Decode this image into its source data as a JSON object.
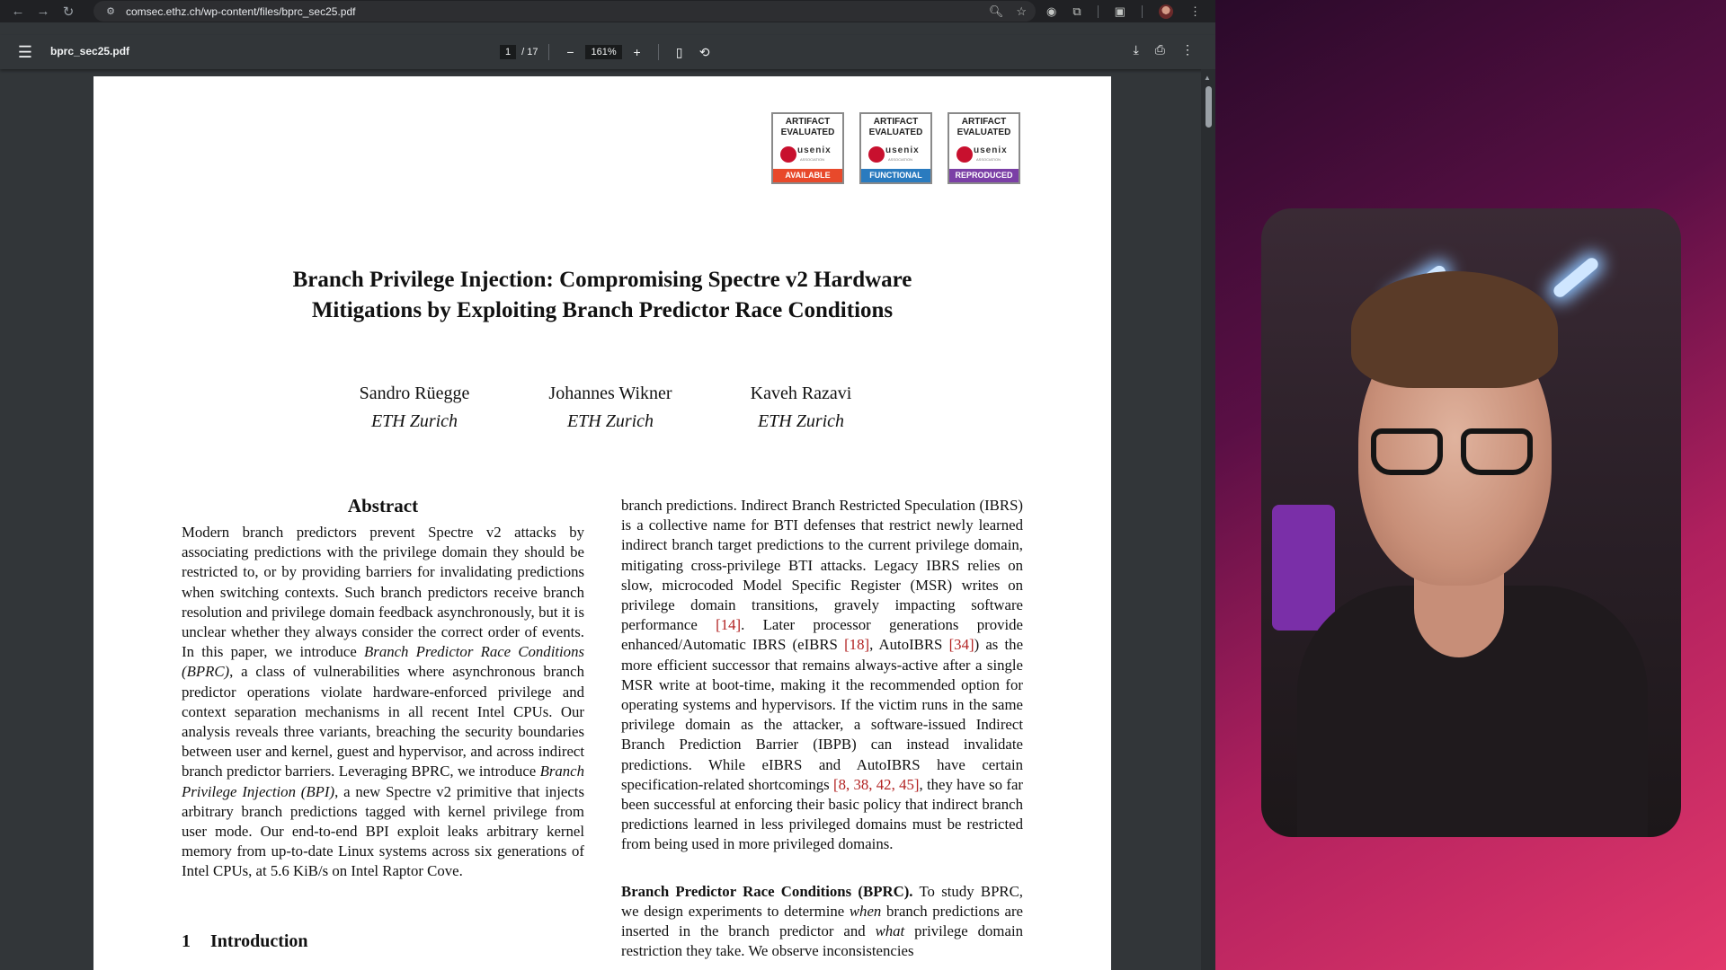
{
  "browser": {
    "url": "comsec.ethz.ch/wp-content/files/bprc_sec25.pdf",
    "icons": [
      "back-icon",
      "forward-icon",
      "reload-icon",
      "site-info-icon",
      "zoom-icon",
      "star-icon",
      "extension-icon",
      "puzzle-icon",
      "tab-search-icon",
      "profile-avatar",
      "more-icon"
    ]
  },
  "pdf_toolbar": {
    "filename": "bprc_sec25.pdf",
    "page_current": "1",
    "page_total": "/ 17",
    "zoom": "161%",
    "zoom_out": "−",
    "zoom_in": "+"
  },
  "badges": [
    {
      "line1": "ARTIFACT",
      "line2": "EVALUATED",
      "org": "usenix",
      "assoc": "ASSOCIATION",
      "band": "AVAILABLE",
      "color": "#e8492b"
    },
    {
      "line1": "ARTIFACT",
      "line2": "EVALUATED",
      "org": "usenix",
      "assoc": "ASSOCIATION",
      "band": "FUNCTIONAL",
      "color": "#2a7bbf"
    },
    {
      "line1": "ARTIFACT",
      "line2": "EVALUATED",
      "org": "usenix",
      "assoc": "ASSOCIATION",
      "band": "REPRODUCED",
      "color": "#7b3fa6"
    }
  ],
  "paper": {
    "title_line1": "Branch Privilege Injection: Compromising Spectre v2 Hardware",
    "title_line2": "Mitigations by Exploiting Branch Predictor Race Conditions",
    "authors": [
      {
        "name": "Sandro Rüegge",
        "affiliation": "ETH Zurich"
      },
      {
        "name": "Johannes Wikner",
        "affiliation": "ETH Zurich"
      },
      {
        "name": "Kaveh Razavi",
        "affiliation": "ETH Zurich"
      }
    ],
    "abstract_heading": "Abstract",
    "abstract": {
      "p1": "Modern branch predictors prevent Spectre v2 attacks by associating predictions with the privilege domain they should be restricted to, or by providing barriers for invalidating predictions when switching contexts. Such branch predictors receive branch resolution and privilege domain feedback asynchronously, but it is unclear whether they always consider the correct order of events. In this paper, we introduce ",
      "em1": "Branch Predictor Race Conditions (BPRC)",
      "p2": ", a class of vulnerabilities where asynchronous branch predictor operations violate hardware-enforced privilege and context separation mechanisms in all recent Intel CPUs. Our analysis reveals three variants, breaching the security boundaries between user and kernel, guest and hypervisor, and across indirect branch predictor barriers. Leveraging BPRC, we introduce ",
      "em2": "Branch Privilege Injection (BPI)",
      "p3": ", a new Spectre v2 primitive that injects arbitrary branch predictions tagged with kernel privilege from user mode. Our end-to-end BPI exploit leaks arbitrary kernel memory from up-to-date Linux systems across six generations of Intel CPUs, at 5.6 KiB/s on Intel Raptor Cove."
    },
    "intro_number": "1",
    "intro_heading": "Introduction",
    "right_col": {
      "t1": "branch predictions. Indirect Branch Restricted Speculation (IBRS) is a collective name for BTI defenses that restrict newly learned indirect branch target predictions to the current privilege domain, mitigating cross-privilege BTI attacks. Legacy IBRS relies on slow, microcoded Model Specific Register (MSR) writes on privilege domain transitions, gravely impacting software performance ",
      "r1": "[14]",
      "t2": ". Later processor generations provide enhanced/Automatic IBRS (eIBRS ",
      "r2": "[18]",
      "t3": ", AutoIBRS ",
      "r3": "[34]",
      "t4": ") as the more efficient successor that remains always-active after a single MSR write at boot-time, making it the recommended option for operating systems and hypervisors. If the victim runs in the same privilege domain as the attacker, a software-issued Indirect Branch Prediction Barrier (IBPB) can instead invalidate predictions. While eIBRS and AutoIBRS have certain specification-related shortcomings ",
      "r4": "[8, 38, 42, 45]",
      "t5": ", they have so far been successful at enforcing their basic policy that indirect branch predictions learned in less privileged domains must be restricted from being used in more privileged domains.",
      "bprc_heading": "Branch Predictor Race Conditions (BPRC).",
      "b1": " To study BPRC, we design experiments to determine ",
      "b_em1": "when",
      "b2": " branch predictions are inserted in the branch predictor and ",
      "b_em2": "what",
      "b3": " privilege domain restriction they take. We observe inconsistencies"
    }
  }
}
